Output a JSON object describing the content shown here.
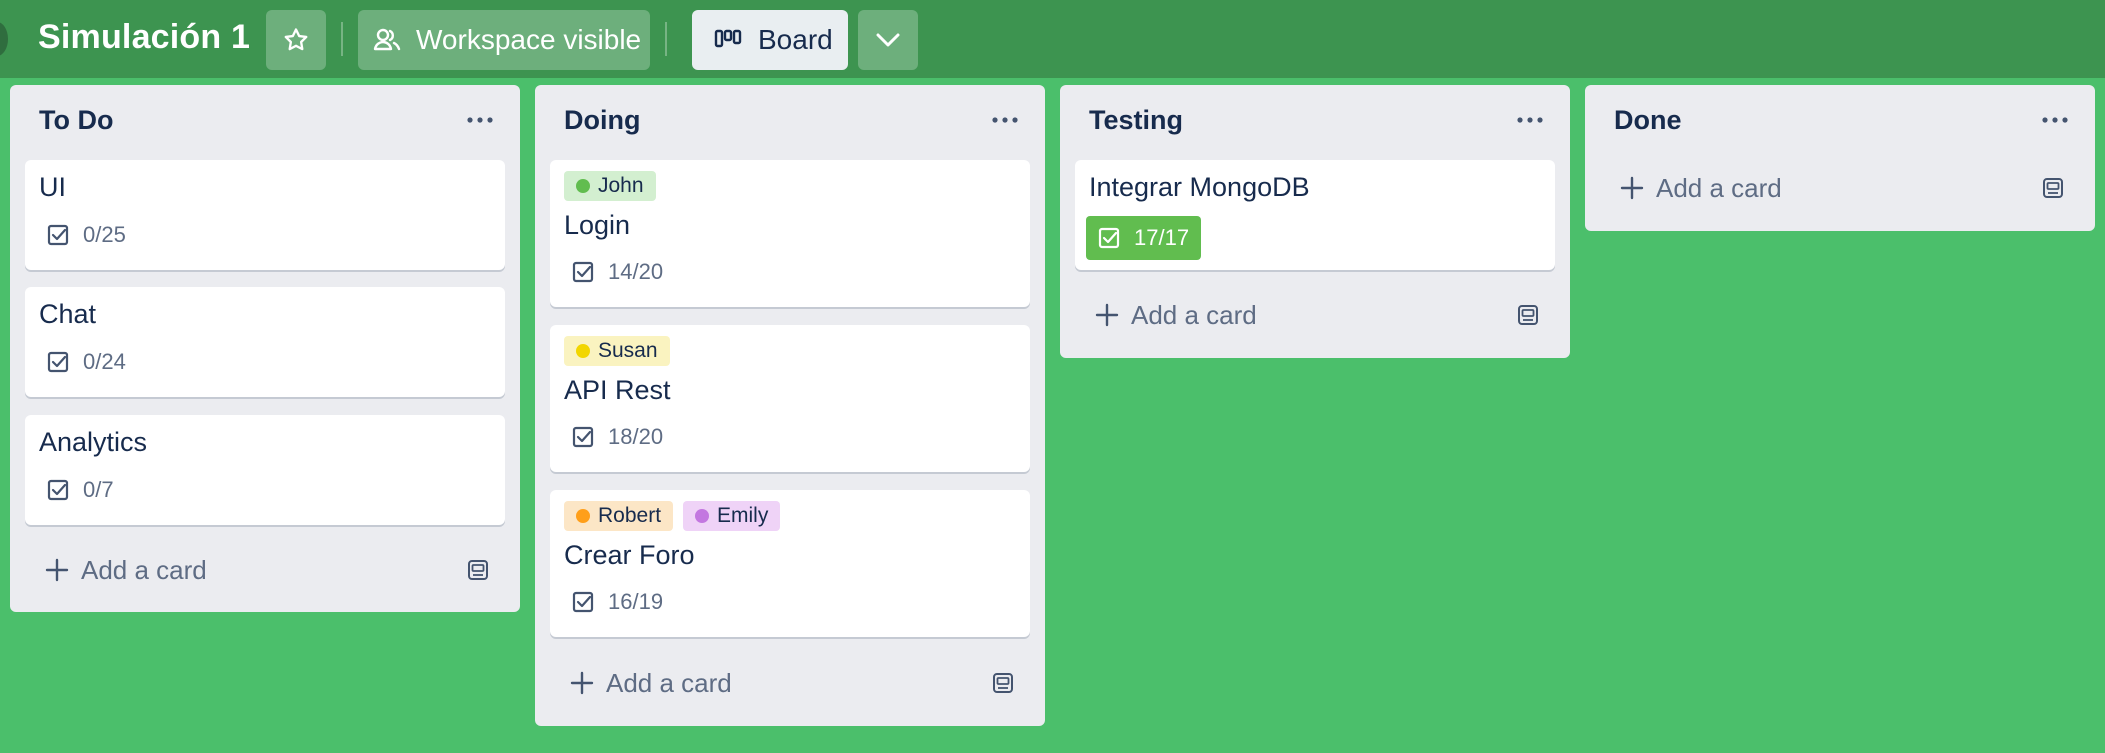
{
  "board": {
    "title": "Simulación 1",
    "visibility_label": "Workspace visible",
    "view_label": "Board"
  },
  "lists": [
    {
      "title": "To Do",
      "cards": [
        {
          "title": "UI",
          "checklist": "0/25"
        },
        {
          "title": "Chat",
          "checklist": "0/24"
        },
        {
          "title": "Analytics",
          "checklist": "0/7"
        }
      ]
    },
    {
      "title": "Doing",
      "cards": [
        {
          "title": "Login",
          "checklist": "14/20",
          "labels": [
            {
              "text": "John",
              "color": "#61bd4f"
            }
          ]
        },
        {
          "title": "API Rest",
          "checklist": "18/20",
          "labels": [
            {
              "text": "Susan",
              "color": "#f2d600"
            }
          ]
        },
        {
          "title": "Crear Foro",
          "checklist": "16/19",
          "labels": [
            {
              "text": "Robert",
              "color": "#ff9f1a"
            },
            {
              "text": "Emily",
              "color": "#c377e0"
            }
          ]
        }
      ]
    },
    {
      "title": "Testing",
      "cards": [
        {
          "title": "Integrar MongoDB",
          "checklist": "17/17",
          "checklist_complete": true
        }
      ]
    },
    {
      "title": "Done",
      "cards": []
    }
  ],
  "add_card_label": "Add a card",
  "icons": {
    "star": "star-icon",
    "visibility": "people-icon",
    "board": "board-icon",
    "chevron": "chevron-down-icon",
    "list_menu": "more-icon",
    "checklist": "checkbox-icon",
    "add": "plus-icon",
    "template": "card-template-icon"
  },
  "colors": {
    "background": "#4bbf6b",
    "header": "#3d9450",
    "list": "#ebecf0",
    "checklist_done": "#61bd4f"
  }
}
